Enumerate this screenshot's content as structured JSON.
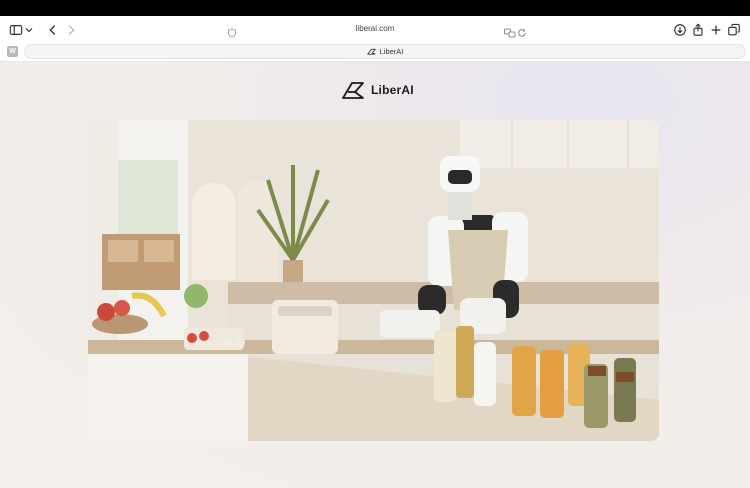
{
  "browser": {
    "url": "liberai.com",
    "tab_title": "LiberAI",
    "tab_favicon_letter": "W",
    "icons": {
      "sidebar": "sidebar-icon",
      "chevron": "chevron-down-icon",
      "back": "back-icon",
      "forward": "forward-icon",
      "shield": "privacy-shield-icon",
      "translate": "translate-icon",
      "reload": "reload-icon",
      "download": "download-icon",
      "share": "share-icon",
      "new_tab": "plus-icon",
      "tab_overview": "tabs-overview-icon"
    }
  },
  "page": {
    "brand_name": "LiberAI",
    "accent": "#1a1a1a",
    "hero_description_icon": "humanoid-robot-kitchen-image"
  }
}
